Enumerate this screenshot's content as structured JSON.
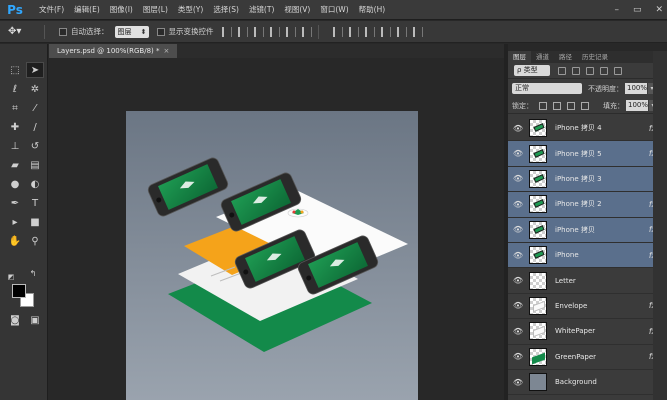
{
  "app": {
    "logo": "Ps"
  },
  "menu": [
    "文件(F)",
    "编辑(E)",
    "图像(I)",
    "图层(L)",
    "类型(Y)",
    "选择(S)",
    "滤镜(T)",
    "视图(V)",
    "窗口(W)",
    "帮助(H)"
  ],
  "window_controls": {
    "minimize": "–",
    "restore": "▭",
    "close": "✕"
  },
  "options_bar": {
    "tool_icon": "move-tool-icon",
    "auto_select_label": "自动选择：",
    "auto_select_value": "图层",
    "show_transform_label": "显示变换控件"
  },
  "document": {
    "tab_label": "Layers.psd @ 100%(RGB/8) *",
    "close": "×"
  },
  "panel": {
    "tabs": [
      "图层",
      "通道",
      "路径",
      "历史记录"
    ],
    "filter_label": "ρ 类型",
    "blend_mode": "正常",
    "opacity_label": "不透明度：",
    "opacity_value": "100%",
    "lock_label": "锁定：",
    "fill_label": "填充：",
    "fill_value": "100%",
    "layers": [
      {
        "name": "iPhone 拷贝 4",
        "fx": "fx",
        "selected": false,
        "thumb": "phone"
      },
      {
        "name": "iPhone 拷贝 5",
        "fx": "fx",
        "selected": true,
        "thumb": "phone"
      },
      {
        "name": "iPhone 拷贝 3",
        "fx": "",
        "selected": true,
        "thumb": "phone"
      },
      {
        "name": "iPhone 拷贝 2",
        "fx": "fx",
        "selected": true,
        "thumb": "phone"
      },
      {
        "name": "iPhone 拷贝",
        "fx": "fx",
        "selected": true,
        "thumb": "phone"
      },
      {
        "name": "iPhone",
        "fx": "fx",
        "selected": true,
        "thumb": "phone"
      },
      {
        "name": "Letter",
        "fx": "",
        "selected": false,
        "thumb": "empty"
      },
      {
        "name": "Envelope",
        "fx": "fx",
        "selected": false,
        "thumb": "paper"
      },
      {
        "name": "WhitePaper",
        "fx": "fx",
        "selected": false,
        "thumb": "paper"
      },
      {
        "name": "GreenPaper",
        "fx": "fx",
        "selected": false,
        "thumb": "green"
      },
      {
        "name": "Background",
        "fx": "",
        "selected": false,
        "thumb": "gray"
      }
    ]
  },
  "colors": {
    "accent": "#31a8ff",
    "selection": "#5a6f8c",
    "green_paper": "#138a4a",
    "orange_paper": "#f5a31a"
  }
}
